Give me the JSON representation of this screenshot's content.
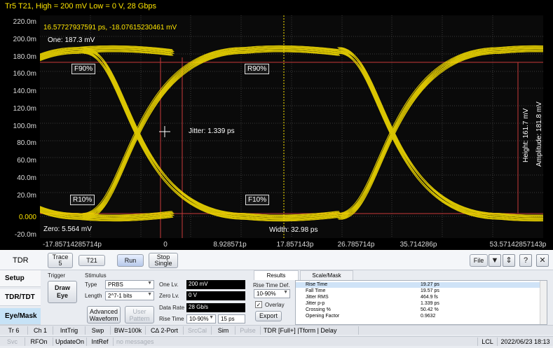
{
  "scope": {
    "title": "Tr5 T21, High = 200 mV Low = 0 V, 28 Gbps",
    "cursor_readout": "16.57727937591 ps, -18.07615230461 mV",
    "one_level": "One: 187.3 mV",
    "zero_level": "Zero: 5.564 mV",
    "jitter": "Jitter: 1.339 ps",
    "width": "Width: 32.98 ps",
    "height": "Height: 161.7 mV",
    "amplitude": "Amplitude: 181.8 mV",
    "markers": {
      "f90": "F90%",
      "r90": "R90%",
      "r10": "R10%",
      "f10": "F10%"
    },
    "trace_color": "#ffe600",
    "y_ticks": [
      "220.0m",
      "200.0m",
      "180.0m",
      "160.0m",
      "140.0m",
      "120.0m",
      "100.0m",
      "80.0m",
      "60.0m",
      "40.0m",
      "20.0m",
      "0.000",
      "-20.0m"
    ],
    "x_ticks": [
      "-17.85714285714p",
      "0",
      "8.928571p",
      "17.857143p",
      "26.785714p",
      "35.714286p",
      "53.57142857143p"
    ]
  },
  "panel": {
    "title": "TDR",
    "trace_button": "Trace\n5",
    "param_button": "T21",
    "run_button": "Run",
    "stop_button": "Stop\nSingle",
    "file_button": "File",
    "icons": [
      "dropdown-icon",
      "swap-icon",
      "help-icon",
      "close-icon"
    ],
    "side_tabs": [
      "Setup",
      "TDR/TDT",
      "Eye/Mask"
    ],
    "trigger": {
      "group": "Trigger",
      "button": "Draw\nEye"
    },
    "stimulus": {
      "group": "Stimulus",
      "type_label": "Type",
      "type_value": "PRBS",
      "length_label": "Length",
      "length_value": "2^7-1 bits",
      "advanced_button": "Advanced\nWaveform",
      "user_button": "User\nPattern",
      "one_label": "One Lv.",
      "one_value": "200 mV",
      "zero_label": "Zero Lv.",
      "zero_value": "0 V",
      "rate_label": "Data Rate",
      "rate_value": "28 Gb/s",
      "rise_label": "Rise Time",
      "rise_def": "10-90%",
      "rise_value": "15 ps"
    },
    "results": {
      "tabs": [
        "Results",
        "Scale/Mask"
      ],
      "rise_def_label": "Rise Time Def.",
      "rise_def_value": "10-90%",
      "overlay_label": "Overlay",
      "export_button": "Export",
      "rows": [
        {
          "name": "Rise Time",
          "value": "19.27 ps"
        },
        {
          "name": "Fall Time",
          "value": "19.57 ps"
        },
        {
          "name": "Jitter RMS",
          "value": "464.9 fs"
        },
        {
          "name": "Jitter p-p",
          "value": "1.339 ps"
        },
        {
          "name": "Crossing %",
          "value": "50.42 %"
        },
        {
          "name": "Opening Factor",
          "value": "0.9632"
        }
      ]
    }
  },
  "status1": [
    "Tr 6",
    "Ch 1",
    "IntTrig",
    "Swp",
    "BW=100k",
    "C∆ 2-Port",
    "SrcCal",
    "Sim",
    "Pulse",
    "TDR [Full+] |Tform | Delay"
  ],
  "status2": [
    "Svc",
    "RFOn",
    "UpdateOn",
    "IntRef",
    "no messages",
    "LCL",
    "2022/06/23 18:13"
  ]
}
